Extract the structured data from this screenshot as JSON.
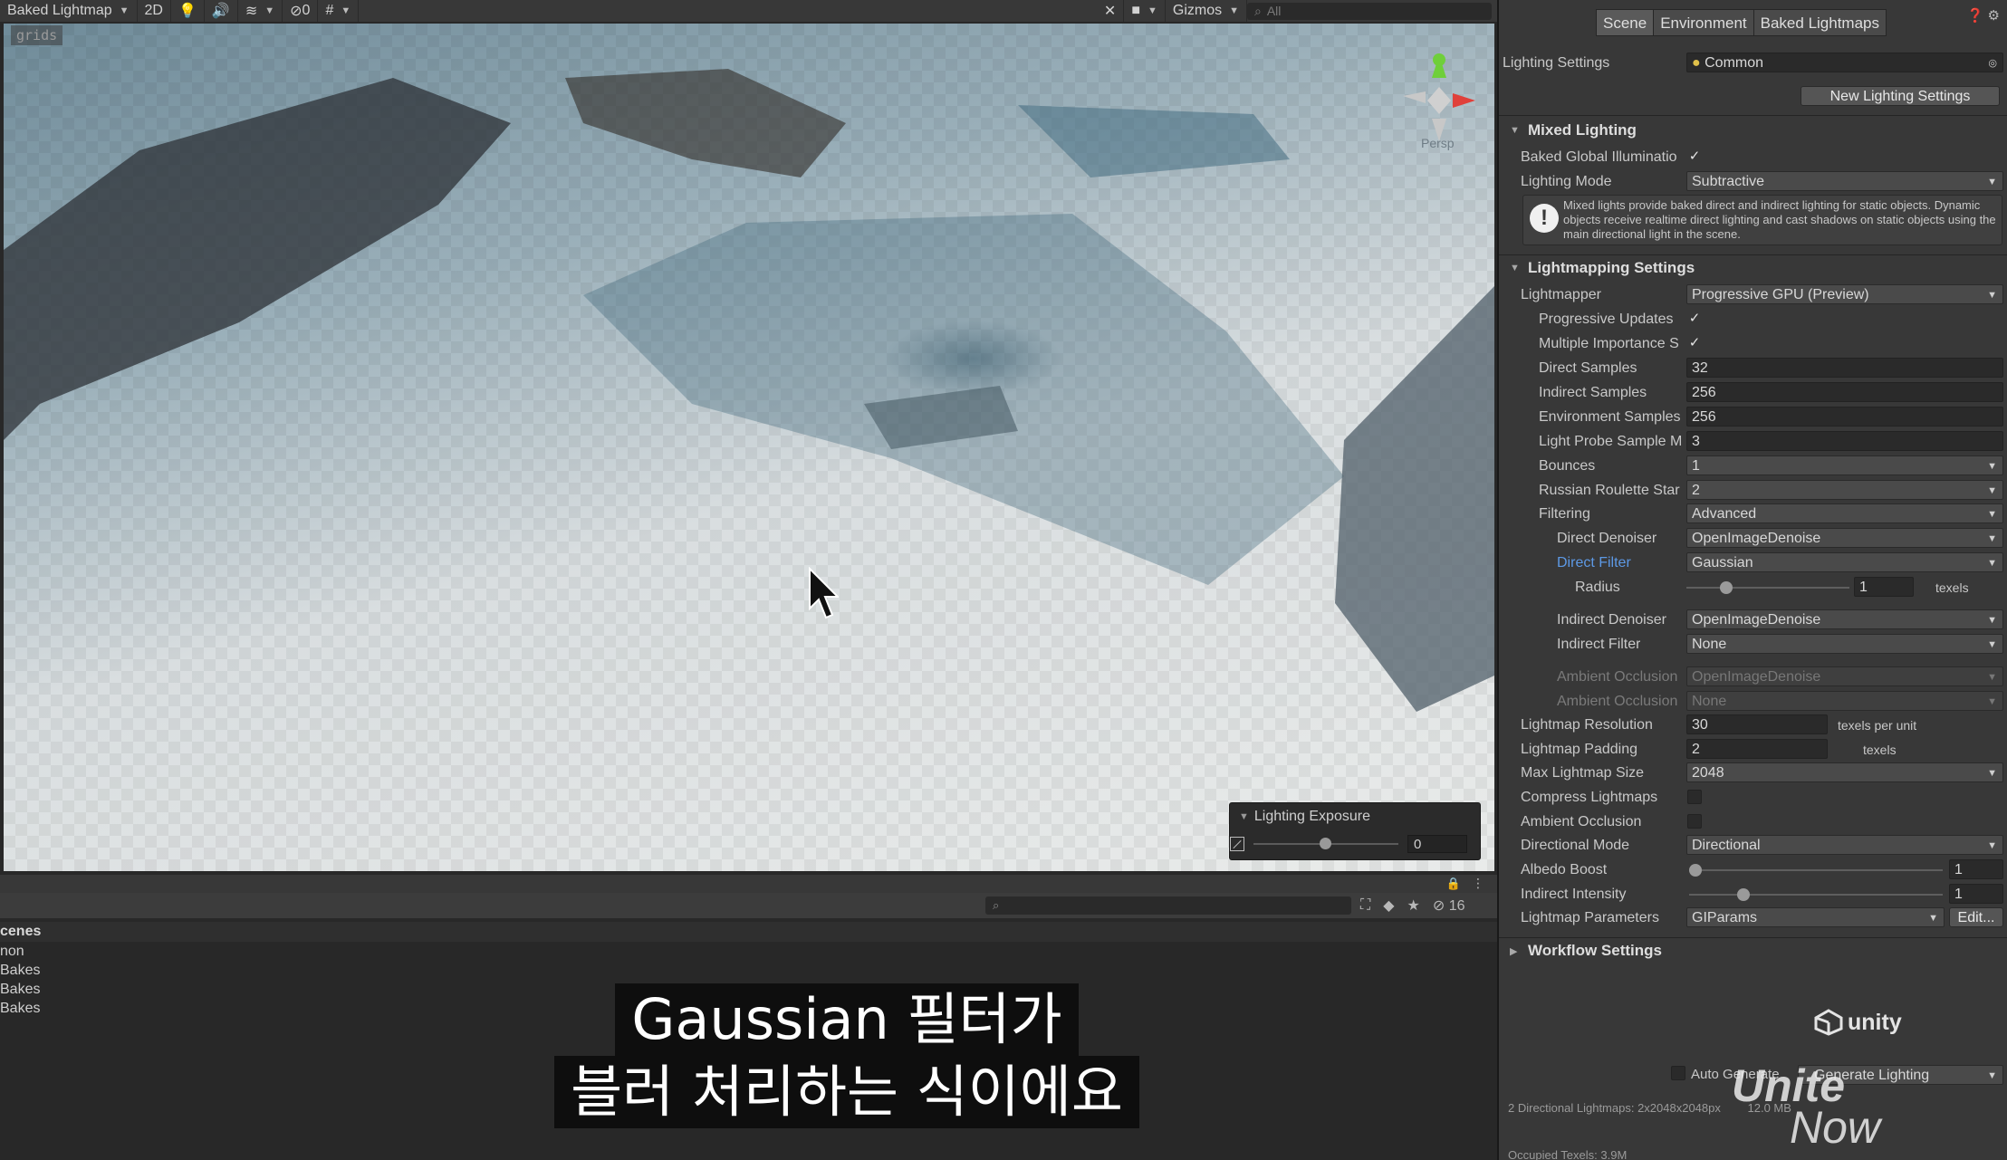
{
  "scene_toolbar": {
    "view_name": "Baked Lightmap",
    "mode_2d": "2D",
    "hidden_count": "0",
    "gizmos_label": "Gizmos",
    "search_placeholder": "All"
  },
  "viewport": {
    "grids_label": "grids",
    "persp_label": "Persp",
    "lighting_exposure": {
      "title": "Lighting Exposure",
      "value": "0",
      "slider_fraction": 0.5
    }
  },
  "bottom_panel": {
    "visible_count": "16",
    "scenes_header": "cenes",
    "scene_items": [
      "non",
      "Bakes",
      "Bakes",
      "Bakes"
    ]
  },
  "subtitles": {
    "line1": "Gaussian 필터가",
    "line2": "블러 처리하는 식이에요"
  },
  "inspector": {
    "tabs": [
      "Scene",
      "Environment",
      "Baked Lightmaps"
    ],
    "active_tab": "Scene",
    "lighting_settings_label": "Lighting Settings",
    "lighting_settings_value": "Common",
    "new_lighting_settings_button": "New Lighting Settings",
    "mixed_lighting": {
      "header": "Mixed Lighting",
      "baked_gi_label": "Baked Global Illuminatio",
      "baked_gi_checked": true,
      "lighting_mode_label": "Lighting Mode",
      "lighting_mode_value": "Subtractive",
      "info_text": "Mixed lights provide baked direct and indirect lighting for static objects. Dynamic objects receive realtime direct lighting and cast shadows on static objects using the main directional light in the scene."
    },
    "lightmapping": {
      "header": "Lightmapping Settings",
      "lightmapper_label": "Lightmapper",
      "lightmapper_value": "Progressive GPU (Preview)",
      "progressive_updates_label": "Progressive Updates",
      "progressive_updates_checked": true,
      "multiple_importance_label": "Multiple Importance S",
      "multiple_importance_checked": true,
      "direct_samples_label": "Direct Samples",
      "direct_samples_value": "32",
      "indirect_samples_label": "Indirect Samples",
      "indirect_samples_value": "256",
      "environment_samples_label": "Environment Samples",
      "environment_samples_value": "256",
      "light_probe_label": "Light Probe Sample M",
      "light_probe_value": "3",
      "bounces_label": "Bounces",
      "bounces_value": "1",
      "russian_roulette_label": "Russian Roulette Star",
      "russian_roulette_value": "2",
      "filtering_label": "Filtering",
      "filtering_value": "Advanced",
      "direct_denoiser_label": "Direct Denoiser",
      "direct_denoiser_value": "OpenImageDenoise",
      "direct_filter_label": "Direct Filter",
      "direct_filter_value": "Gaussian",
      "radius_label": "Radius",
      "radius_value": "1",
      "radius_unit": "texels",
      "radius_slider_fraction": 0.22,
      "indirect_denoiser_label": "Indirect Denoiser",
      "indirect_denoiser_value": "OpenImageDenoise",
      "indirect_filter_label": "Indirect Filter",
      "indirect_filter_value": "None",
      "ao_denoiser_label": "Ambient Occlusion",
      "ao_denoiser_value": "OpenImageDenoise",
      "ao_filter_label": "Ambient Occlusion",
      "ao_filter_value": "None",
      "lightmap_resolution_label": "Lightmap Resolution",
      "lightmap_resolution_value": "30",
      "lightmap_resolution_unit": "texels per unit",
      "lightmap_padding_label": "Lightmap Padding",
      "lightmap_padding_value": "2",
      "lightmap_padding_unit": "texels",
      "max_lightmap_size_label": "Max Lightmap Size",
      "max_lightmap_size_value": "2048",
      "compress_lightmaps_label": "Compress Lightmaps",
      "compress_lightmaps_checked": false,
      "ambient_occlusion_label": "Ambient Occlusion",
      "ambient_occlusion_checked": false,
      "directional_mode_label": "Directional Mode",
      "directional_mode_value": "Directional",
      "albedo_boost_label": "Albedo Boost",
      "albedo_boost_value": "1",
      "albedo_boost_fraction": 0.0,
      "indirect_intensity_label": "Indirect Intensity",
      "indirect_intensity_value": "1",
      "indirect_intensity_fraction": 0.2,
      "lightmap_parameters_label": "Lightmap Parameters",
      "lightmap_parameters_value": "GIParams",
      "edit_button": "Edit..."
    },
    "workflow_header": "Workflow Settings",
    "unity_logo_text": "unity",
    "auto_generate_label": "Auto Generate",
    "generate_lighting_button": "Generate Lighting",
    "stats_line1": "2 Directional Lightmaps: 2x2048x2048px",
    "stats_size": "12.0 MB",
    "stats_line2": "Occupied Texels: 3.9M",
    "unite_line1": "Unite",
    "unite_line2": "Now"
  },
  "colors": {
    "accent_blue": "#5d99e5",
    "panel_bg": "#383838",
    "subtitle_bg": "#0e0e0e"
  }
}
